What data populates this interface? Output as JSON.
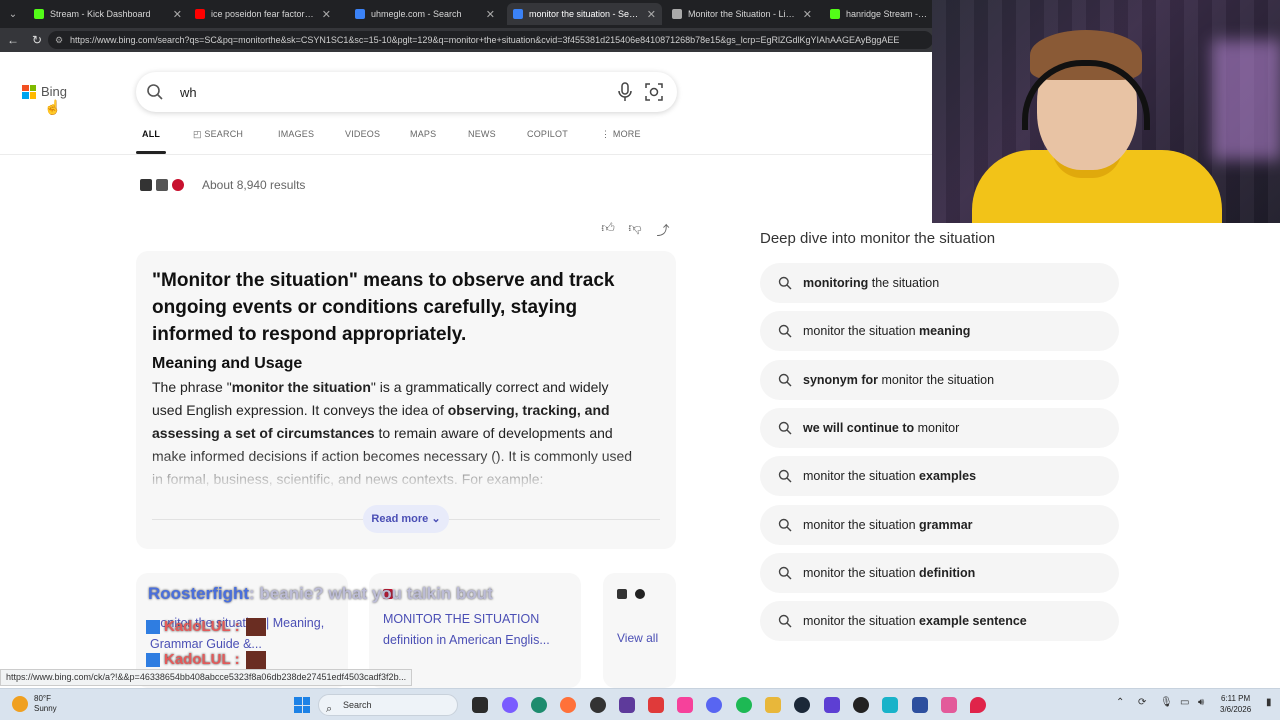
{
  "browser": {
    "tabs": [
      {
        "title": "Stream - Kick Dashboard",
        "color": "#53fc18",
        "active": false
      },
      {
        "title": "ice poseidon fear factor - YouTube",
        "color": "#ff0000",
        "active": false
      },
      {
        "title": "uhmegle.com - Search",
        "color": "#3b82f6",
        "active": false
      },
      {
        "title": "monitor the situation - Search",
        "color": "#3b82f6",
        "active": true
      },
      {
        "title": "Monitor the Situation - Live Globa",
        "color": "#aaaaaa",
        "active": false
      },
      {
        "title": "hanridge Stream - W",
        "color": "#53fc18",
        "active": false
      }
    ],
    "url": "https://www.bing.com/search?qs=SC&pq=monitorthe&sk=CSYN1SC1&sc=15-10&pglt=129&q=monitor+the+situation&cvid=3f455381d215406e8410871268b78e15&gs_lcrp=EgRlZGdlKgYIAhAAGEAyBggAEE"
  },
  "bing": {
    "logo_text": "Bing",
    "search_value": "wh",
    "scopes": [
      "ALL",
      "SEARCH",
      "IMAGES",
      "VIDEOS",
      "MAPS",
      "NEWS",
      "COPILOT",
      "MORE"
    ],
    "results_count": "About 8,940 results",
    "answer": {
      "title": "\"Monitor the situation\" means to observe and track ongoing events or conditions carefully, staying informed to respond appropriately.",
      "subheading": "Meaning and Usage",
      "body_1": "The phrase \"",
      "body_b1": "monitor the situation",
      "body_2": "\" is a grammatically correct and widely used English expression. It conveys the idea of ",
      "body_b2": "observing, tracking, and assessing a set of circumstances",
      "body_3": " to remain aware of developments and make informed decisions if action becomes necessary (). It is commonly used in formal, business, scientific, and news contexts. For example:",
      "read_more": "Read more"
    },
    "sources": [
      {
        "title": "monitor the situation | Meaning, Grammar Guide &..."
      },
      {
        "title": "MONITOR THE SITUATION definition in American Englis..."
      }
    ],
    "view_all": "View all",
    "deep_dive_title": "Deep dive into monitor the situation",
    "suggestions": [
      {
        "bold_first": true,
        "bold": "monitoring",
        "rest": " the situation"
      },
      {
        "bold_first": false,
        "pre": "monitor the situation ",
        "bold": "meaning"
      },
      {
        "bold_first": true,
        "bold": "synonym for",
        "rest": " monitor the situation"
      },
      {
        "bold_first": true,
        "bold": "we will continue to",
        "rest": " monitor"
      },
      {
        "bold_first": false,
        "pre": "monitor the situation ",
        "bold": "examples"
      },
      {
        "bold_first": false,
        "pre": "monitor the situation ",
        "bold": "grammar"
      },
      {
        "bold_first": false,
        "pre": "monitor the situation ",
        "bold": "definition"
      },
      {
        "bold_first": false,
        "pre": "monitor the situation ",
        "bold": "example sentence"
      }
    ]
  },
  "overlay": {
    "chat_user": "Roosterfight",
    "chat_msg": ": beanie? what you talkin bout",
    "kado_user": "KadoLUL",
    "kado_sep": ":"
  },
  "status_url": "https://www.bing.com/ck/a?!&&p=46338654bb408abcce5323f8a06db238de27451edf4503cadf3f2b...",
  "taskbar": {
    "temp": "80°F",
    "condition": "Sunny",
    "search_label": "Search",
    "time": "6:11 PM",
    "date": "3/6/2026"
  }
}
